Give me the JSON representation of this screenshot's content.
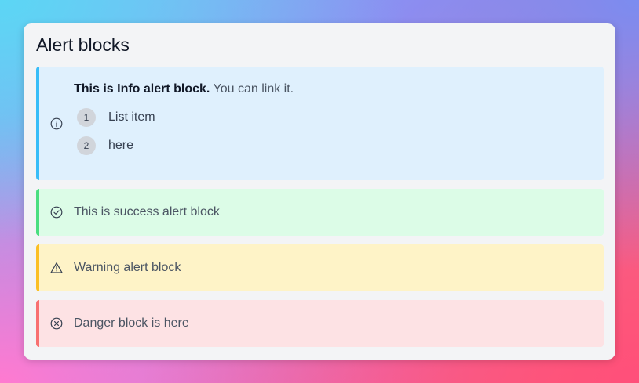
{
  "title": "Alert blocks",
  "alerts": {
    "info": {
      "icon": "info-circle-icon",
      "bold_text": "This is Info alert block.",
      "rest_text": " You can link it.",
      "list": [
        {
          "number": "1",
          "label": "List item"
        },
        {
          "number": "2",
          "label": "here"
        }
      ],
      "color": "#38bdf8"
    },
    "success": {
      "icon": "check-circle-icon",
      "text": "This is success alert block",
      "color": "#4ade80"
    },
    "warning": {
      "icon": "warning-triangle-icon",
      "text": "Warning alert block",
      "color": "#fbbf24"
    },
    "danger": {
      "icon": "x-circle-icon",
      "text": "Danger block is here",
      "color": "#f87171"
    }
  }
}
